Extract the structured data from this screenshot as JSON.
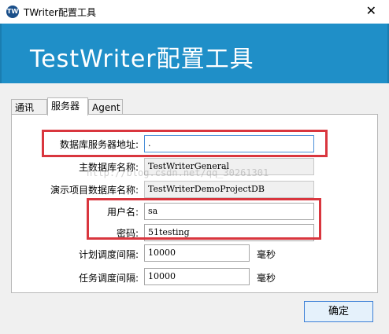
{
  "window": {
    "title": "TWriter配置工具",
    "icon_label": "TW"
  },
  "banner": {
    "title": "TestWriter配置工具"
  },
  "tabs": [
    {
      "label": "通讯"
    },
    {
      "label": "服务器"
    },
    {
      "label": "Agent"
    }
  ],
  "form": {
    "db_server": {
      "label": "数据库服务器地址:",
      "value": "."
    },
    "main_db": {
      "label": "主数据库名称:",
      "value": "TestWriterGeneral"
    },
    "demo_db": {
      "label": "演示项目数据库名称:",
      "value": "TestWriterDemoProjectDB"
    },
    "username": {
      "label": "用户名:",
      "value": "sa"
    },
    "password": {
      "label": "密码:",
      "value": "51testing"
    },
    "plan_interval": {
      "label": "计划调度间隔:",
      "value": "10000",
      "unit": "毫秒"
    },
    "task_interval": {
      "label": "任务调度间隔:",
      "value": "10000",
      "unit": "毫秒"
    }
  },
  "watermark": "http://blog.csdn.net/qq_30261301",
  "buttons": {
    "ok": "确定"
  },
  "colors": {
    "banner": "#1f8fc8",
    "highlight": "#d9363e"
  }
}
